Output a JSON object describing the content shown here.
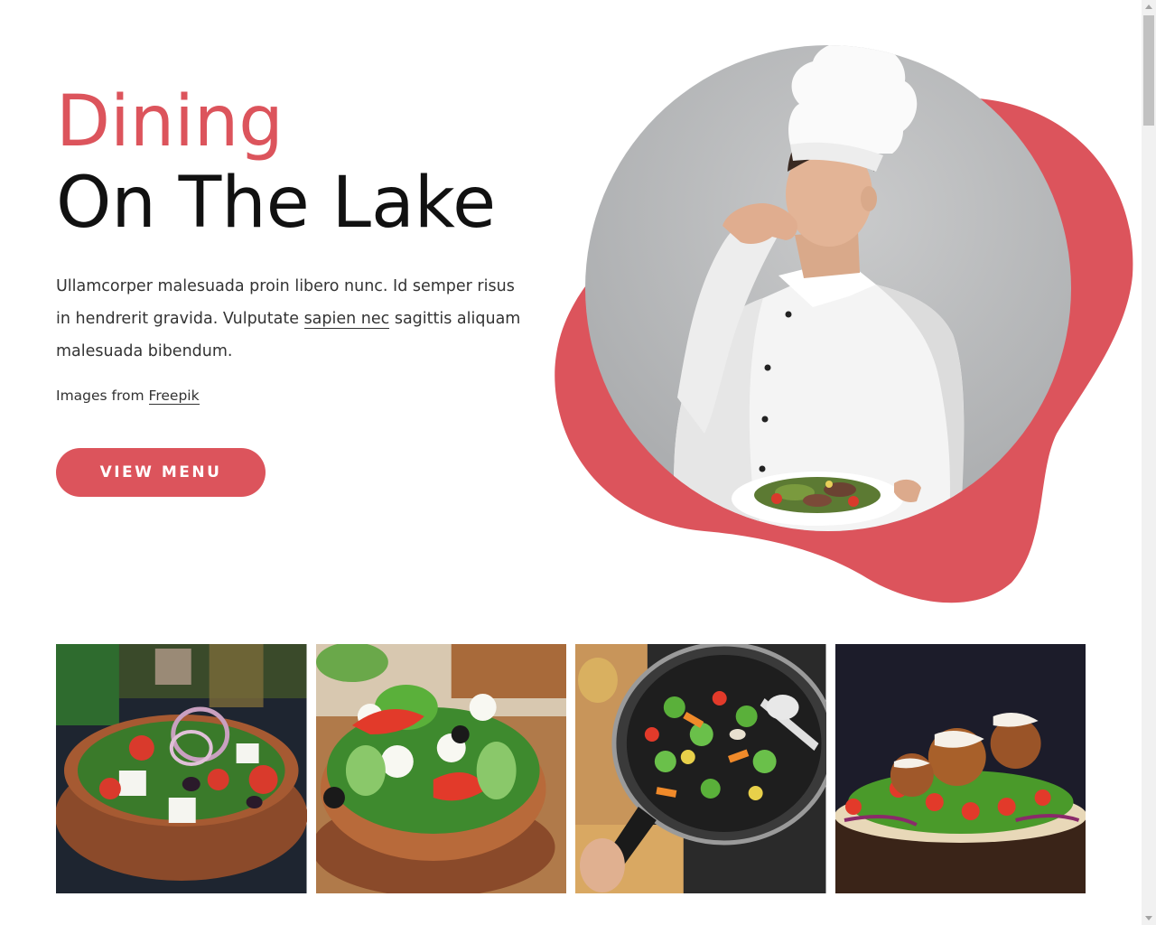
{
  "hero": {
    "title_line1": "Dining",
    "title_line2": "On The Lake",
    "description_part1": "Ullamcorper malesuada proin libero nunc. Id semper risus in hendrerit gravida. Vulputate ",
    "description_link": "sapien nec",
    "description_part2": " sagittis aliquam malesuada bibendum.",
    "credit_text": "Images from ",
    "credit_link": "Freepik",
    "button_label": "VIEW MENU"
  },
  "colors": {
    "accent": "#dc545c",
    "heading": "#111111",
    "body_text": "#333333",
    "background": "#ffffff"
  },
  "hero_image": {
    "description": "chef-kissing-fingers-holding-salad-plate"
  },
  "gallery": {
    "items": [
      {
        "name": "greek-salad-bowl"
      },
      {
        "name": "mozzarella-salad-wooden-bowl"
      },
      {
        "name": "vegetable-stir-fry-pan"
      },
      {
        "name": "falafel-flatbread"
      }
    ]
  }
}
